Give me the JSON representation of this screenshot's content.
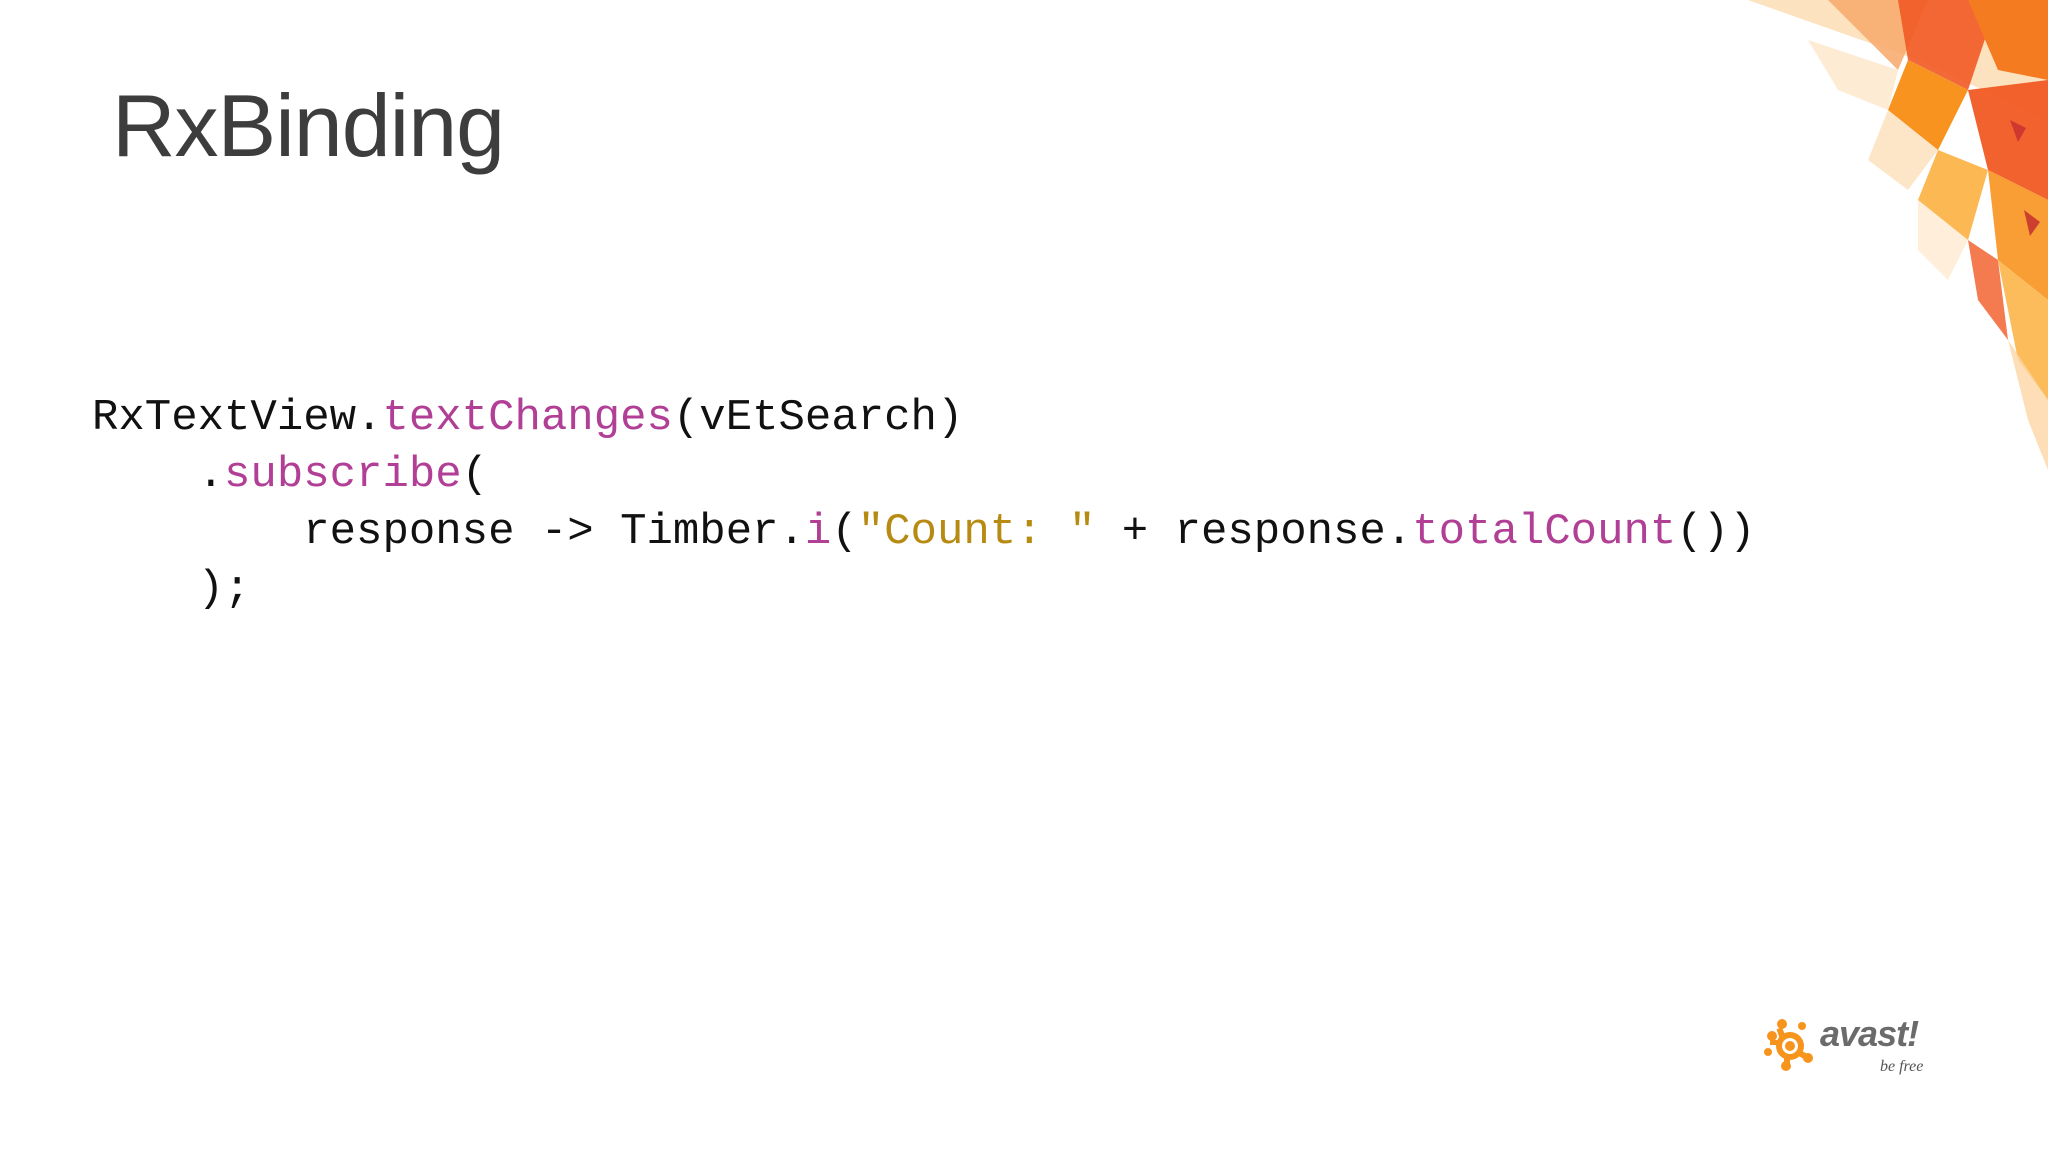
{
  "slide": {
    "title": "RxBinding"
  },
  "code": {
    "lines": [
      [
        {
          "text": "RxTextView.",
          "kind": "plain"
        },
        {
          "text": "textChanges",
          "kind": "method"
        },
        {
          "text": "(vEtSearch)",
          "kind": "plain"
        }
      ],
      [
        {
          "text": "    .",
          "kind": "plain"
        },
        {
          "text": "subscribe",
          "kind": "method"
        },
        {
          "text": "(",
          "kind": "plain"
        }
      ],
      [
        {
          "text": "        response -> Timber.",
          "kind": "plain"
        },
        {
          "text": "i",
          "kind": "method"
        },
        {
          "text": "(",
          "kind": "plain"
        },
        {
          "text": "\"Count: \"",
          "kind": "string"
        },
        {
          "text": " + response.",
          "kind": "plain"
        },
        {
          "text": "totalCount",
          "kind": "method"
        },
        {
          "text": "())",
          "kind": "plain"
        }
      ],
      [
        {
          "text": "    );",
          "kind": "plain"
        }
      ]
    ],
    "colors": {
      "plain": "#111111",
      "method": "#b13f95",
      "string": "#b78a12"
    }
  },
  "logo": {
    "wordmark": "avast!",
    "tagline": "be free",
    "icon": "avast-orange-splash-icon",
    "colors": {
      "icon": "#f7941d",
      "text": "#6b6b6b"
    }
  },
  "decor": {
    "icon": "orange-polygon-art",
    "colors": [
      "#f15a24",
      "#f7931e",
      "#fbb040",
      "#fcd6a4"
    ]
  }
}
